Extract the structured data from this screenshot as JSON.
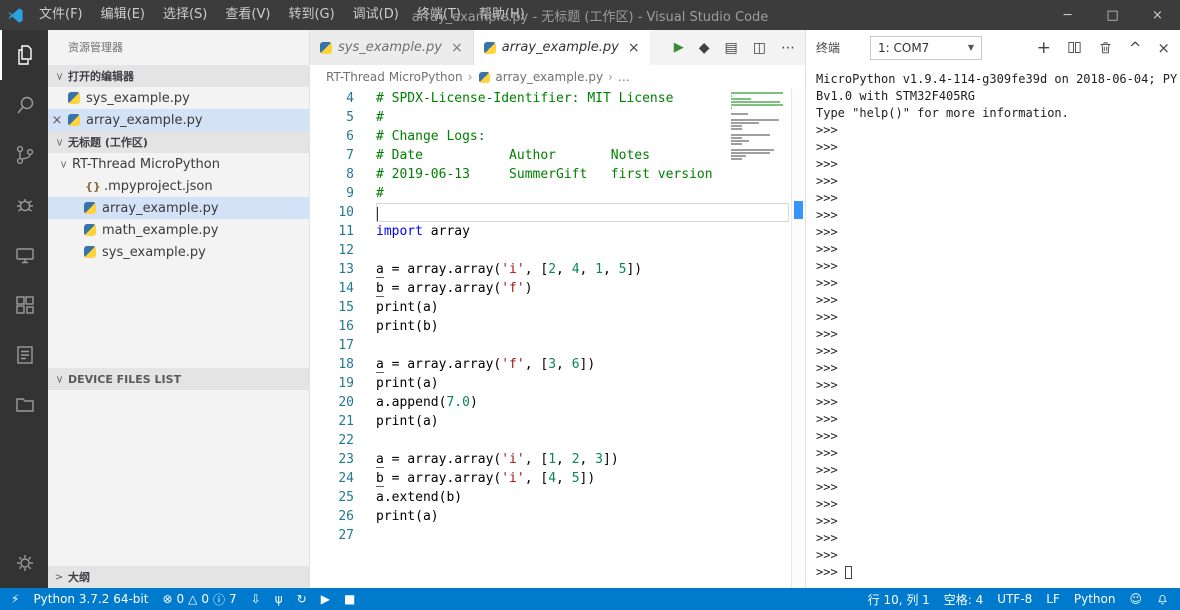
{
  "window": {
    "title": "array_example.py - 无标题 (工作区) - Visual Studio Code",
    "menus": [
      "文件(F)",
      "编辑(E)",
      "选择(S)",
      "查看(V)",
      "转到(G)",
      "调试(D)",
      "终端(T)",
      "帮助(H)"
    ]
  },
  "icons": {
    "close": "×",
    "minimize": "─",
    "maximize": "□",
    "crumb_sep": "›",
    "dropdown_caret": "▼",
    "run": "▶",
    "stop": "■",
    "sync": "↻",
    "usb": "ψ",
    "download": "⇩",
    "lightning": "⚡",
    "error": "⊗",
    "warning": "△",
    "info": "ⓘ",
    "plus": "+",
    "chevron_up": "^",
    "more": "⋯",
    "split": "◫",
    "file": "▤",
    "diamond": "◆",
    "smiley": "☺",
    "json": "{}"
  },
  "colors": {
    "statusbar": "#007acc",
    "titlebar": "#3c3c3c",
    "activitybar": "#333333",
    "selection": "#d4e2f8",
    "run_green": "#388a34",
    "comment": "#008000",
    "keyword": "#0000ff",
    "string": "#a31515",
    "number": "#098658",
    "line_number": "#237893"
  },
  "sidebar": {
    "title": "资源管理器",
    "open_editors": {
      "label": "打开的编辑器",
      "items": [
        {
          "label": "sys_example.py",
          "selected": false,
          "closable": false
        },
        {
          "label": "array_example.py",
          "selected": true,
          "closable": true
        }
      ]
    },
    "workspace": {
      "label": "无标题 (工作区)",
      "folder": "RT-Thread MicroPython",
      "files": [
        {
          "label": ".mpyproject.json",
          "icon": "json",
          "selected": false
        },
        {
          "label": "array_example.py",
          "icon": "python",
          "selected": true
        },
        {
          "label": "math_example.py",
          "icon": "python",
          "selected": false
        },
        {
          "label": "sys_example.py",
          "icon": "python",
          "selected": false
        }
      ]
    },
    "device_files_label": "DEVICE FILES LIST",
    "outline_label": "大纲"
  },
  "editor": {
    "tabs": [
      {
        "label": "sys_example.py",
        "active": false
      },
      {
        "label": "array_example.py",
        "active": true
      }
    ],
    "breadcrumb": [
      "RT-Thread MicroPython",
      "array_example.py",
      "…"
    ],
    "lines": [
      {
        "num": 4,
        "tokens": [
          [
            "c",
            "# SPDX-License-Identifier: MIT License"
          ]
        ]
      },
      {
        "num": 5,
        "tokens": [
          [
            "c",
            "#"
          ]
        ]
      },
      {
        "num": 6,
        "tokens": [
          [
            "c",
            "# Change Logs:"
          ]
        ]
      },
      {
        "num": 7,
        "tokens": [
          [
            "c",
            "# Date           Author       Notes"
          ]
        ]
      },
      {
        "num": 8,
        "tokens": [
          [
            "c",
            "# 2019-06-13     SummerGift   first version"
          ]
        ]
      },
      {
        "num": 9,
        "tokens": [
          [
            "c",
            "#"
          ]
        ]
      },
      {
        "num": 10,
        "tokens": [],
        "current": true
      },
      {
        "num": 11,
        "tokens": [
          [
            "k",
            "import"
          ],
          [
            "p",
            " array"
          ]
        ]
      },
      {
        "num": 12,
        "tokens": []
      },
      {
        "num": 13,
        "tokens": [
          [
            "u",
            "a"
          ],
          [
            "p",
            " = array.array("
          ],
          [
            "s",
            "'i'"
          ],
          [
            "p",
            ", ["
          ],
          [
            "n",
            "2"
          ],
          [
            "p",
            ", "
          ],
          [
            "n",
            "4"
          ],
          [
            "p",
            ", "
          ],
          [
            "n",
            "1"
          ],
          [
            "p",
            ", "
          ],
          [
            "n",
            "5"
          ],
          [
            "p",
            "])"
          ]
        ]
      },
      {
        "num": 14,
        "tokens": [
          [
            "u",
            "b"
          ],
          [
            "p",
            " = array.array("
          ],
          [
            "s",
            "'f'"
          ],
          [
            "p",
            ")"
          ]
        ]
      },
      {
        "num": 15,
        "tokens": [
          [
            "p",
            "print(a)"
          ]
        ]
      },
      {
        "num": 16,
        "tokens": [
          [
            "p",
            "print(b)"
          ]
        ]
      },
      {
        "num": 17,
        "tokens": []
      },
      {
        "num": 18,
        "tokens": [
          [
            "u",
            "a"
          ],
          [
            "p",
            " = array.array("
          ],
          [
            "s",
            "'f'"
          ],
          [
            "p",
            ", ["
          ],
          [
            "n",
            "3"
          ],
          [
            "p",
            ", "
          ],
          [
            "n",
            "6"
          ],
          [
            "p",
            "])"
          ]
        ]
      },
      {
        "num": 19,
        "tokens": [
          [
            "p",
            "print(a)"
          ]
        ]
      },
      {
        "num": 20,
        "tokens": [
          [
            "p",
            "a.append("
          ],
          [
            "n",
            "7.0"
          ],
          [
            "p",
            ")"
          ]
        ]
      },
      {
        "num": 21,
        "tokens": [
          [
            "p",
            "print(a)"
          ]
        ]
      },
      {
        "num": 22,
        "tokens": []
      },
      {
        "num": 23,
        "tokens": [
          [
            "u",
            "a"
          ],
          [
            "p",
            " = array.array("
          ],
          [
            "s",
            "'i'"
          ],
          [
            "p",
            ", ["
          ],
          [
            "n",
            "1"
          ],
          [
            "p",
            ", "
          ],
          [
            "n",
            "2"
          ],
          [
            "p",
            ", "
          ],
          [
            "n",
            "3"
          ],
          [
            "p",
            "])"
          ]
        ]
      },
      {
        "num": 24,
        "tokens": [
          [
            "u",
            "b"
          ],
          [
            "p",
            " = array.array("
          ],
          [
            "s",
            "'i'"
          ],
          [
            "p",
            ", ["
          ],
          [
            "n",
            "4"
          ],
          [
            "p",
            ", "
          ],
          [
            "n",
            "5"
          ],
          [
            "p",
            "])"
          ]
        ]
      },
      {
        "num": 25,
        "tokens": [
          [
            "p",
            "a.extend(b)"
          ]
        ]
      },
      {
        "num": 26,
        "tokens": [
          [
            "p",
            "print(a)"
          ]
        ]
      },
      {
        "num": 27,
        "tokens": []
      }
    ]
  },
  "terminal": {
    "title": "终端",
    "selector": "1: COM7",
    "banner": [
      "MicroPython v1.9.4-114-g309fe39d on 2018-06-04; PY",
      "Bv1.0 with STM32F405RG",
      "Type \"help()\" for more information."
    ],
    "prompt": ">>>",
    "prompt_count": 27
  },
  "status": {
    "python": "Python 3.7.2 64-bit",
    "errors": "0",
    "warnings": "0",
    "infos": "7",
    "line_col": "行 10, 列 1",
    "indent": "空格: 4",
    "encoding": "UTF-8",
    "eol": "LF",
    "language": "Python"
  }
}
